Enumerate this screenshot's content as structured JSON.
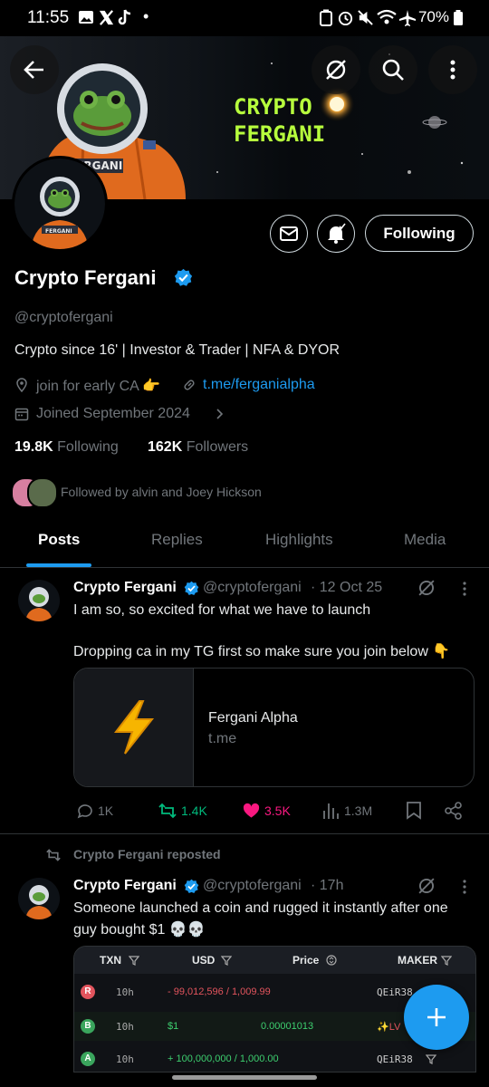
{
  "status_bar": {
    "time": "11:55",
    "dot": "•",
    "battery": "70%"
  },
  "banner": {
    "title_line1": "CRYPTO",
    "title_line2": "FERGANI",
    "suit_label": "FERGANI"
  },
  "profile": {
    "display_name": "Crypto Fergani",
    "handle": "@cryptofergani",
    "bio": "Crypto since 16' | Investor & Trader | NFA & DYOR",
    "location": "join for early CA 👉",
    "link": "t.me/ferganialpha",
    "joined": "Joined September 2024",
    "following_count": "19.8K",
    "following_label": "Following",
    "followers_count": "162K",
    "followers_label": "Followers",
    "followed_by": "Followed by alvin and Joey Hickson",
    "follow_button": "Following",
    "avatar_label": "FERGANI"
  },
  "tabs": [
    "Posts",
    "Replies",
    "Highlights",
    "Media"
  ],
  "post1": {
    "name": "Crypto Fergani",
    "handle": "@cryptofergani",
    "time": "· 12 Oct 25",
    "line1": "I am so, so excited for what we have to launch",
    "line2": "Dropping ca in my TG first so make sure you join below 👇",
    "card_title": "Fergani Alpha",
    "card_domain": "t.me",
    "replies": "1K",
    "reposts": "1.4K",
    "likes": "3.5K",
    "views": "1.3M"
  },
  "post2": {
    "repost_label": "Crypto Fergani reposted",
    "name": "Crypto Fergani",
    "handle": "@cryptofergani",
    "time": "· 17h",
    "line1": "Someone launched a coin and rugged it instantly after one",
    "line2": "guy bought $1 💀💀"
  },
  "txn_table": {
    "headers": [
      "TXN",
      "USD",
      "Price",
      "MAKER"
    ],
    "rows": [
      {
        "badge": "R",
        "age": "10h",
        "usd": "- 99,012,596 / 1,009.99",
        "price": "",
        "maker": "QEiR38"
      },
      {
        "badge": "B",
        "age": "10h",
        "usd": "$1",
        "price": "0.00001013",
        "maker": "✨LV"
      },
      {
        "badge": "A",
        "age": "10h",
        "usd": "+ 100,000,000 / 1,000.00",
        "price": "",
        "maker": "QEiR38"
      }
    ]
  },
  "colors": {
    "accent": "#1d9bf0",
    "like": "#f91880",
    "repost": "#00ba7c",
    "muted": "#71767b"
  }
}
